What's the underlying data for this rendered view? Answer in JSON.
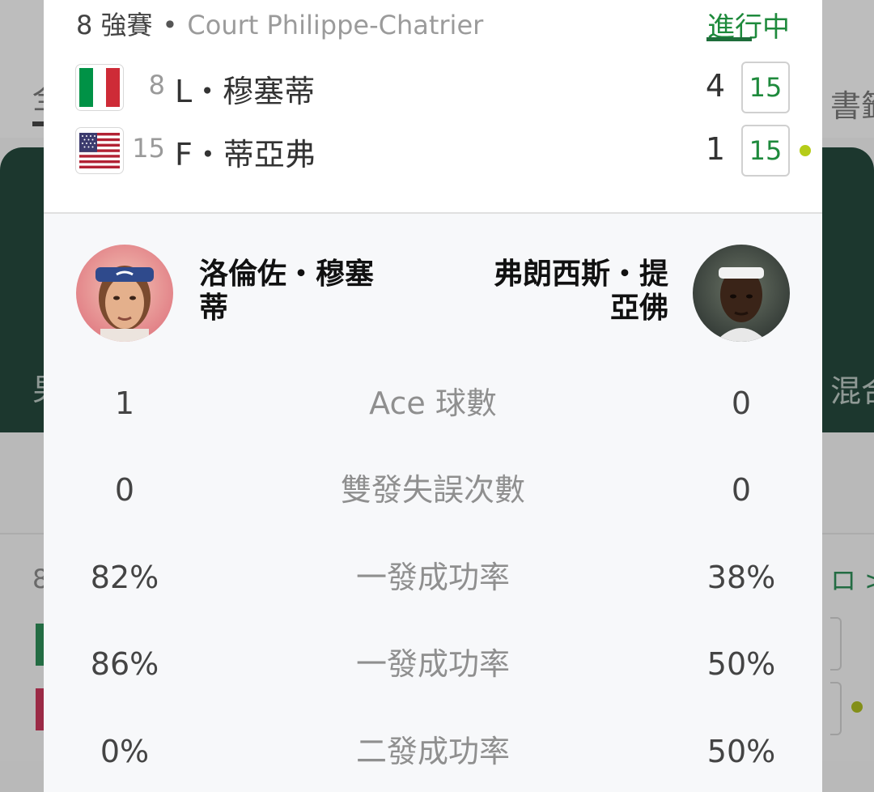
{
  "background": {
    "tab_left": "全",
    "tab_right": "書籤",
    "green_left": "男",
    "green_right": "混合",
    "card_num": "8",
    "card_link": "ロ >"
  },
  "match": {
    "round": "8 強賽",
    "separator": "•",
    "court": "Court Philippe-Chatrier",
    "status": "進行中",
    "colors": {
      "accent_green": "#1e8a3c",
      "serve_dot": "#b5cc18"
    },
    "players": [
      {
        "seed": "8",
        "name": "L・穆塞蒂",
        "flag": "italy-flag-icon",
        "games": "4",
        "points": "15",
        "serving": false
      },
      {
        "seed": "15",
        "name": "F・蒂亞弗",
        "flag": "usa-flag-icon",
        "games": "1",
        "points": "15",
        "serving": true
      }
    ]
  },
  "stats": {
    "left_player": {
      "full_name": "洛倫佐・穆塞蒂",
      "avatar": "player-avatar-icon"
    },
    "right_player": {
      "full_name": "弗朗西斯・提亞佛",
      "avatar": "player-avatar-icon"
    },
    "rows": [
      {
        "left": "1",
        "label": "Ace 球數",
        "right": "0"
      },
      {
        "left": "0",
        "label": "雙發失誤次數",
        "right": "0"
      },
      {
        "left": "82%",
        "label": "一發成功率",
        "right": "38%"
      },
      {
        "left": "86%",
        "label": "一發成功率",
        "right": "50%"
      },
      {
        "left": "0%",
        "label": "二發成功率",
        "right": "50%"
      }
    ]
  }
}
